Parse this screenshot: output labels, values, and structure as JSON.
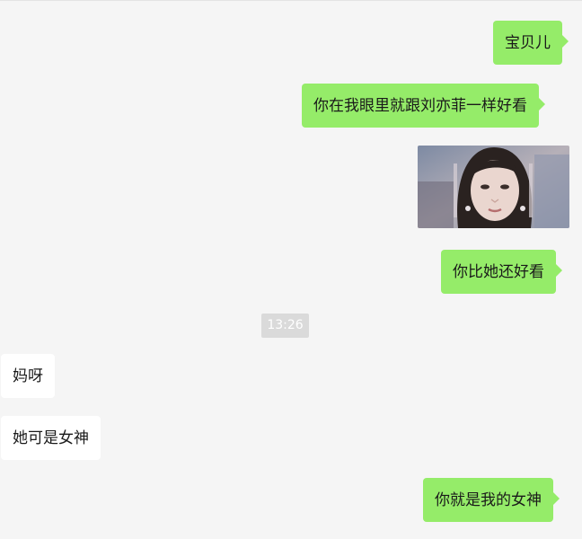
{
  "messages": [
    {
      "side": "outgoing",
      "text": "宝贝儿"
    },
    {
      "side": "outgoing",
      "text": "你在我眼里就跟刘亦菲一样好看"
    },
    {
      "side": "outgoing",
      "type": "image"
    },
    {
      "side": "outgoing",
      "text": "你比她还好看"
    },
    {
      "side": "incoming",
      "text": "妈呀"
    },
    {
      "side": "incoming",
      "text": "她可是女神"
    },
    {
      "side": "outgoing",
      "text": "你就是我的女神"
    }
  ],
  "timestamp": "13:26",
  "colors": {
    "background": "#f5f5f5",
    "outgoing_bubble": "#95ec69",
    "incoming_bubble": "#ffffff",
    "timestamp_bg": "#dadada"
  }
}
